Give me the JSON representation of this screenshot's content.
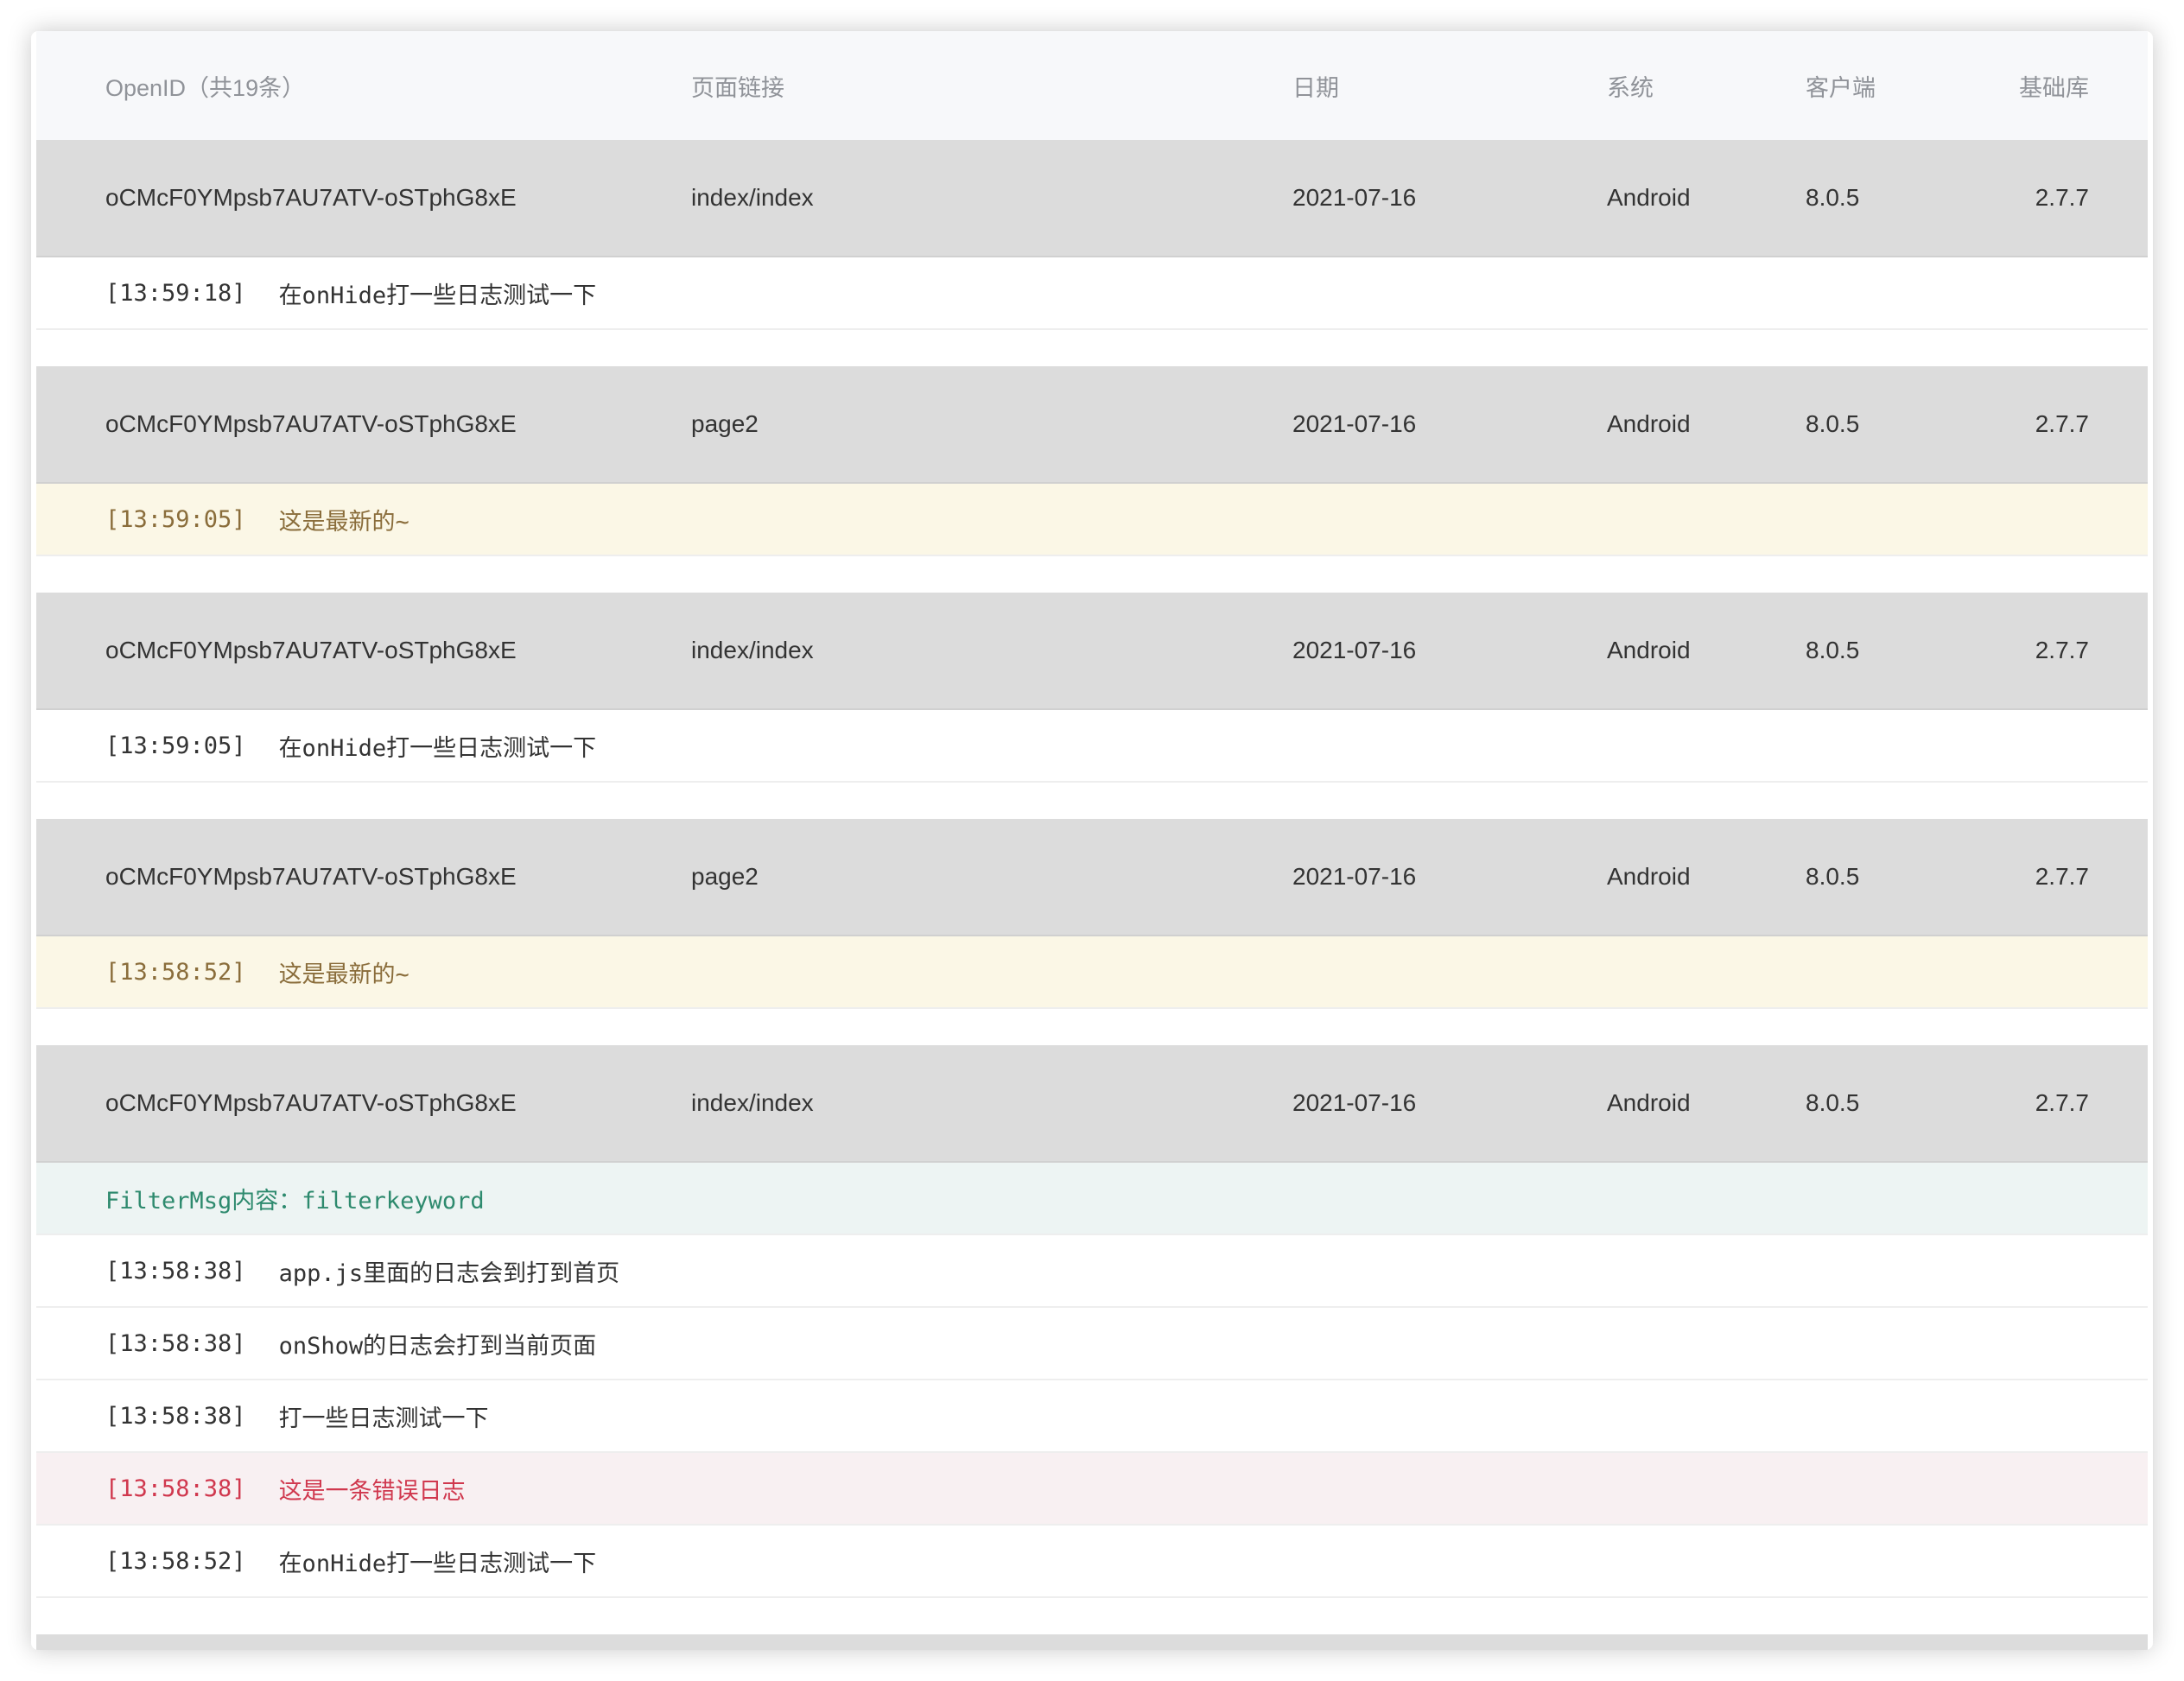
{
  "header": {
    "openid": "OpenID（共19条）",
    "page": "页面链接",
    "date": "日期",
    "system": "系统",
    "client": "客户端",
    "lib": "基础库"
  },
  "groups": [
    {
      "openid": "oCMcF0YMpsb7AU7ATV-oSTphG8xE",
      "page": "index/index",
      "date": "2021-07-16",
      "system": "Android",
      "client": "8.0.5",
      "lib": "2.7.7",
      "logs": [
        {
          "type": "info",
          "time": "[13:59:18]",
          "text": "在onHide打一些日志测试一下"
        }
      ]
    },
    {
      "openid": "oCMcF0YMpsb7AU7ATV-oSTphG8xE",
      "page": "page2",
      "date": "2021-07-16",
      "system": "Android",
      "client": "8.0.5",
      "lib": "2.7.7",
      "logs": [
        {
          "type": "warn",
          "time": "[13:59:05]",
          "text": "这是最新的~"
        }
      ]
    },
    {
      "openid": "oCMcF0YMpsb7AU7ATV-oSTphG8xE",
      "page": "index/index",
      "date": "2021-07-16",
      "system": "Android",
      "client": "8.0.5",
      "lib": "2.7.7",
      "logs": [
        {
          "type": "info",
          "time": "[13:59:05]",
          "text": "在onHide打一些日志测试一下"
        }
      ]
    },
    {
      "openid": "oCMcF0YMpsb7AU7ATV-oSTphG8xE",
      "page": "page2",
      "date": "2021-07-16",
      "system": "Android",
      "client": "8.0.5",
      "lib": "2.7.7",
      "logs": [
        {
          "type": "warn",
          "time": "[13:58:52]",
          "text": "这是最新的~"
        }
      ]
    },
    {
      "openid": "oCMcF0YMpsb7AU7ATV-oSTphG8xE",
      "page": "index/index",
      "date": "2021-07-16",
      "system": "Android",
      "client": "8.0.5",
      "lib": "2.7.7",
      "logs": [
        {
          "type": "filter",
          "time": "",
          "text": "FilterMsg内容：filterkeyword"
        },
        {
          "type": "info",
          "time": "[13:58:38]",
          "text": "app.js里面的日志会到打到首页"
        },
        {
          "type": "info",
          "time": "[13:58:38]",
          "text": "onShow的日志会打到当前页面"
        },
        {
          "type": "info",
          "time": "[13:58:38]",
          "text": "打一些日志测试一下"
        },
        {
          "type": "error",
          "time": "[13:58:38]",
          "text": "这是一条错误日志"
        },
        {
          "type": "info",
          "time": "[13:58:52]",
          "text": "在onHide打一些日志测试一下"
        }
      ]
    }
  ]
}
